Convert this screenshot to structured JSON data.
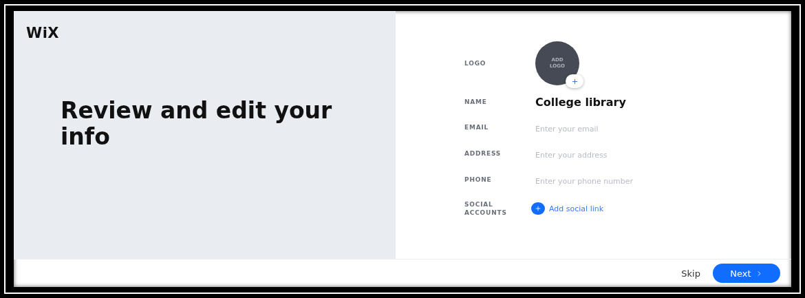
{
  "logo": "WiX",
  "heading": "Review and edit your info",
  "fields": [
    {
      "kind": "logo",
      "label": "LOGO",
      "text": "ADD LOGO"
    },
    {
      "kind": "value",
      "label": "NAME",
      "value": "College library"
    },
    {
      "kind": "input",
      "label": "EMAIL",
      "placeholder": "Enter your email"
    },
    {
      "kind": "input",
      "label": "ADDRESS",
      "placeholder": "Enter your address"
    },
    {
      "kind": "input",
      "label": "PHONE",
      "placeholder": "Enter your phone number"
    },
    {
      "kind": "link",
      "label": "SOCIAL ACCOUNTS",
      "text": "Add social link"
    }
  ],
  "buttons": {
    "skip": "Skip",
    "next": "Next"
  }
}
